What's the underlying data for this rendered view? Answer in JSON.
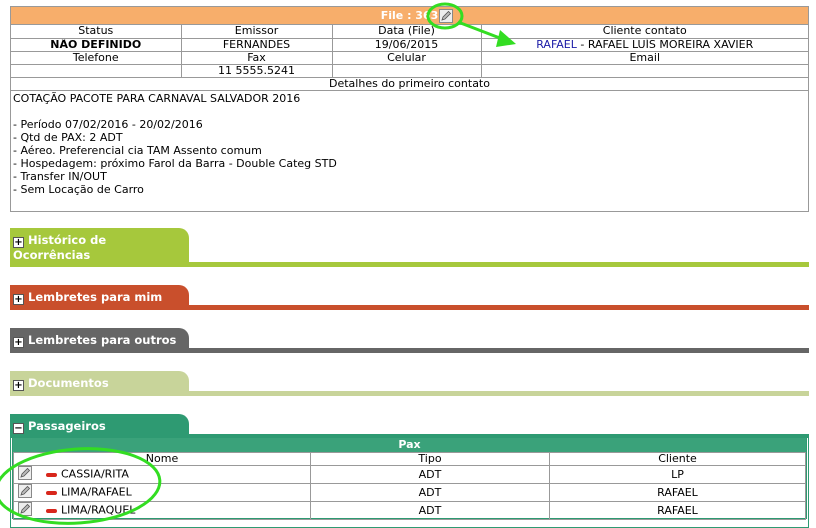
{
  "file": {
    "title": "File : 363",
    "headers": {
      "status": "Status",
      "emissor": "Emissor",
      "data": "Data (File)",
      "cliente_contato": "Cliente contato"
    },
    "values": {
      "status": "NÃO DEFINIDO",
      "emissor": "FERNANDES",
      "data": "19/06/2015",
      "contact_link": "RAFAEL",
      "contact_rest": " - RAFAEL LUÍS MOREIRA XAVIER"
    },
    "headers2": {
      "telefone": "Telefone",
      "fax": "Fax",
      "celular": "Celular",
      "email": "Email"
    },
    "values2": {
      "telefone": "",
      "fax": "11 5555.5241",
      "celular": "",
      "email": ""
    },
    "details_header": "Detalhes do primeiro contato",
    "details_text": "COTAÇÃO PACOTE PARA CARNAVAL SALVADOR 2016\n\n- Período 07/02/2016 - 20/02/2016\n- Qtd de PAX: 2 ADT\n- Aéreo. Preferencial cia TAM Assento comum\n- Hospedagem: próximo Farol da Barra - Double Categ STD\n- Transfer IN/OUT\n- Sem Locação de Carro"
  },
  "sections": {
    "historico": {
      "label": "Histórico de Ocorrências",
      "color": "#a6c83c"
    },
    "lembretes_mim": {
      "label": "Lembretes para mim",
      "color": "#c94f2c"
    },
    "lembretes_outros": {
      "label": "Lembretes para outros",
      "color": "#666666"
    },
    "documentos": {
      "label": "Documentos",
      "color": "#c8d49a"
    },
    "passageiros": {
      "label": "Passageiros",
      "color": "#2e9a72"
    }
  },
  "pax": {
    "title": "Pax",
    "columns": {
      "nome": "Nome",
      "tipo": "Tipo",
      "cliente": "Cliente"
    },
    "rows": [
      {
        "nome": "CASSIA/RITA",
        "tipo": "ADT",
        "cliente": "LP"
      },
      {
        "nome": "LIMA/RAFAEL",
        "tipo": "ADT",
        "cliente": "RAFAEL"
      },
      {
        "nome": "LIMA/RAQUEL",
        "tipo": "ADT",
        "cliente": "RAFAEL"
      }
    ]
  },
  "icons": {
    "edit": "pencil-edit-icon",
    "remove": "minus-remove-icon",
    "expand": "plus-expand-icon",
    "collapse": "minus-collapse-icon"
  }
}
